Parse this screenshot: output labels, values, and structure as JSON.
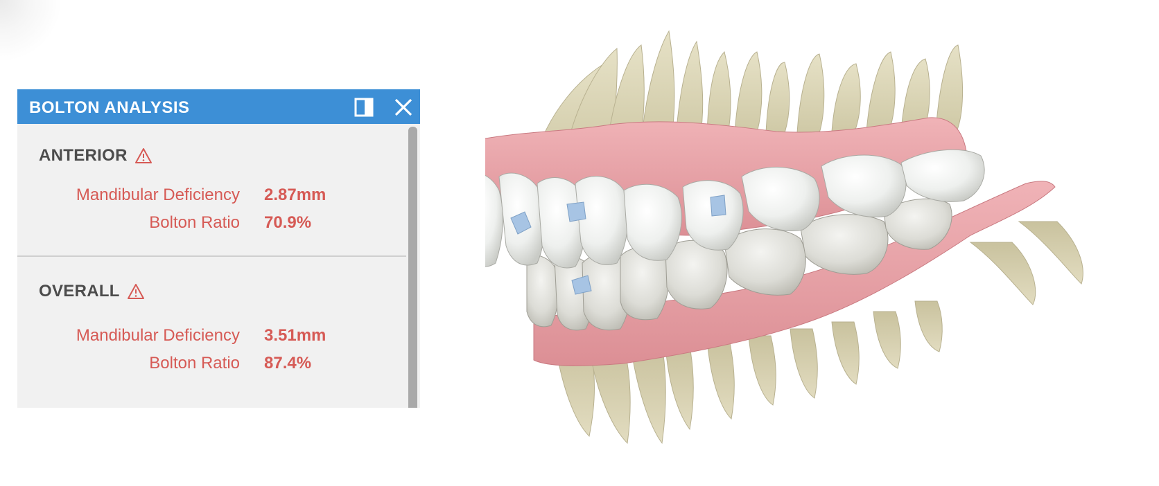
{
  "panel": {
    "title": "BOLTON ANALYSIS",
    "dock_icon": "dock-panel-icon",
    "close_icon": "close-icon"
  },
  "sections": [
    {
      "title": "ANTERIOR",
      "warning_icon": "warning-icon",
      "rows": [
        {
          "label": "Mandibular Deficiency",
          "value": "2.87mm"
        },
        {
          "label": "Bolton Ratio",
          "value": "70.9%"
        }
      ]
    },
    {
      "title": "OVERALL",
      "warning_icon": "warning-icon",
      "rows": [
        {
          "label": "Mandibular Deficiency",
          "value": "3.51mm"
        },
        {
          "label": "Bolton Ratio",
          "value": "87.4%"
        }
      ]
    }
  ],
  "colors": {
    "header": "#3d8fd6",
    "warning": "#d65a55",
    "gum": "#e59aa0",
    "tooth": "#f0f1ee",
    "root": "#d8d3b5",
    "bracket": "#a7c4e4"
  }
}
